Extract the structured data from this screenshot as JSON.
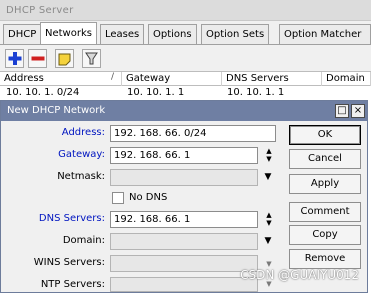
{
  "window": {
    "title": "DHCP Server"
  },
  "tabs": [
    {
      "label": "DHCP",
      "active": false
    },
    {
      "label": "Networks",
      "active": true
    },
    {
      "label": "Leases",
      "active": false
    },
    {
      "label": "Options",
      "active": false
    },
    {
      "label": "Option Sets",
      "active": false
    },
    {
      "label": "Option Matcher",
      "active": false
    }
  ],
  "toolbar": {
    "add": "plus-icon",
    "remove": "minus-icon",
    "comment": "note-icon",
    "filter": "filter-icon"
  },
  "list": {
    "columns": [
      "Address",
      "Gateway",
      "DNS Servers",
      "Domain"
    ],
    "rows": [
      {
        "address": "10. 10. 1. 0/24",
        "gateway": "10. 10. 1. 1",
        "dns": "10. 10. 1. 1"
      }
    ]
  },
  "dialog": {
    "title": "New DHCP Network",
    "labels": {
      "address": "Address:",
      "gateway": "Gateway:",
      "netmask": "Netmask:",
      "no_dns": "No DNS",
      "dns": "DNS Servers:",
      "domain": "Domain:",
      "wins": "WINS Servers:",
      "ntp": "NTP Servers:"
    },
    "values": {
      "address": "192. 168. 66. 0/24",
      "gateway": "192. 168. 66. 1",
      "dns": "192. 168. 66. 1"
    },
    "buttons": {
      "ok": "OK",
      "cancel": "Cancel",
      "apply": "Apply",
      "comment": "Comment",
      "copy": "Copy",
      "remove": "Remove"
    },
    "restore_glyph": "□",
    "close_glyph": "×"
  },
  "watermark": "CSDN @GUAIYU012",
  "colors": {
    "dialog_title_bg": "#6f7fa3",
    "label_blue": "#0015c0",
    "add_blue": "#1a3fd2",
    "remove_red": "#d02020",
    "comment_yellow": "#f4d23c"
  }
}
